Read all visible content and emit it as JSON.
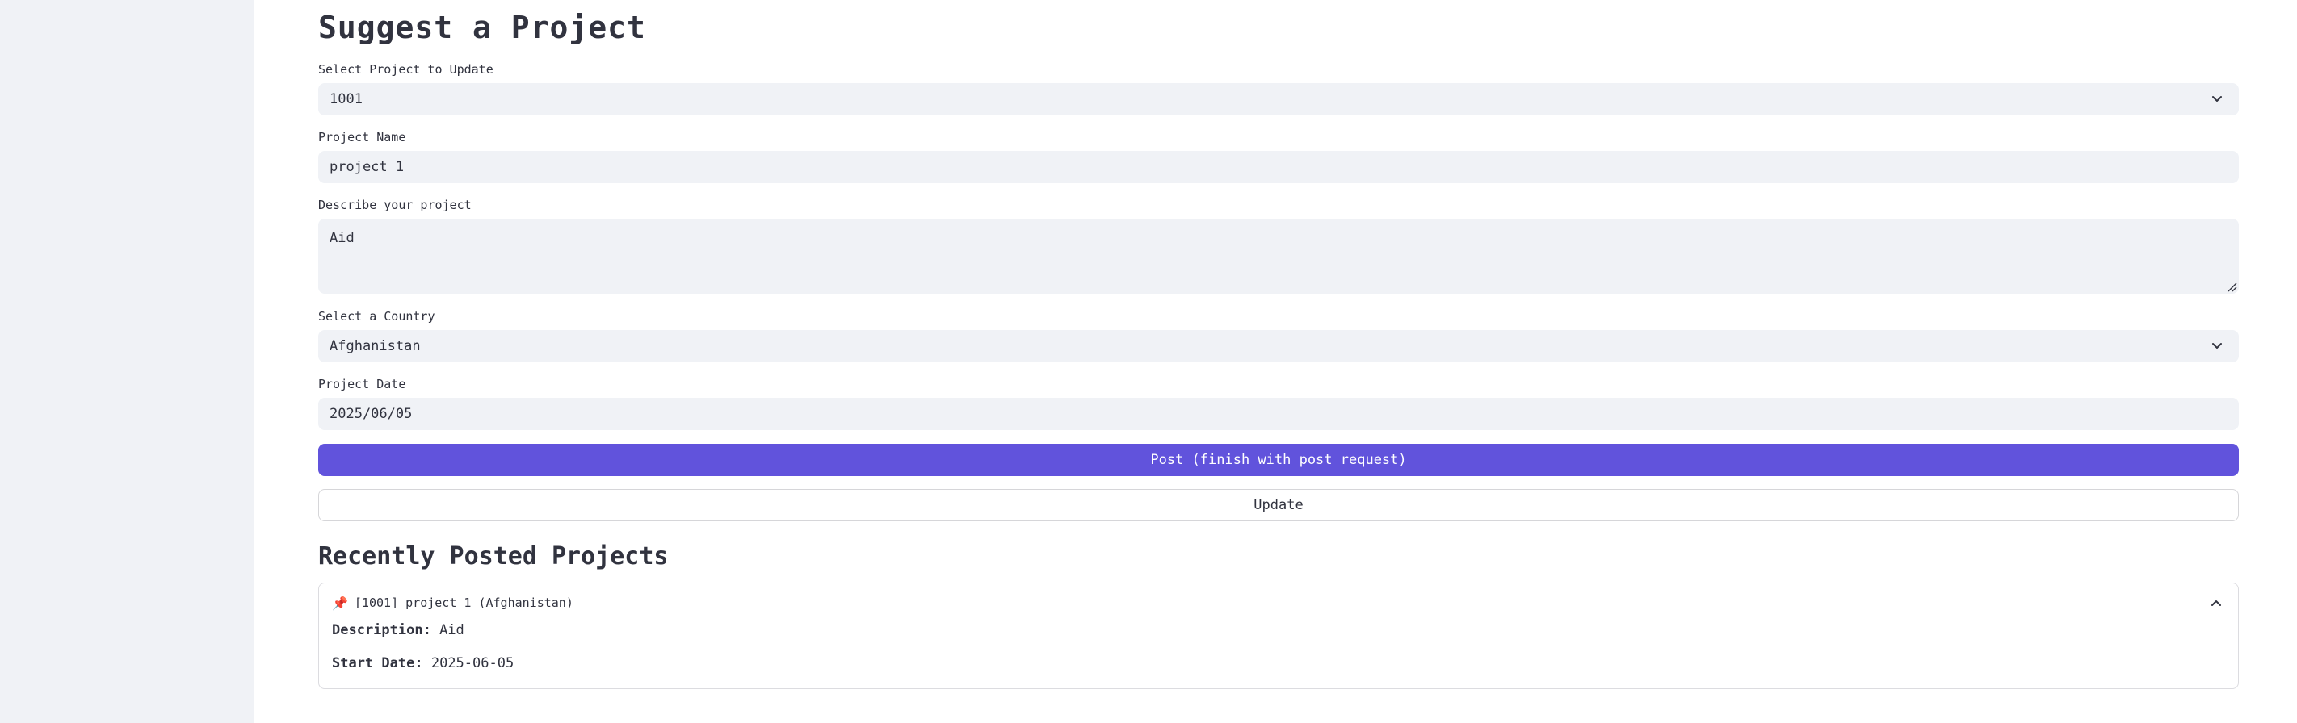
{
  "page": {
    "title": "Suggest a Project",
    "select_project": {
      "label": "Select Project to Update",
      "value": "1001"
    },
    "project_name": {
      "label": "Project Name",
      "value": "project 1"
    },
    "description": {
      "label": "Describe your project",
      "value": "Aid"
    },
    "country": {
      "label": "Select a Country",
      "value": "Afghanistan"
    },
    "project_date": {
      "label": "Project Date",
      "value": "2025/06/05"
    },
    "post_button": "Post (finish with post request)",
    "update_button": "Update",
    "recent_title": "Recently Posted Projects",
    "recent_items": [
      {
        "header": "[1001] project 1 (Afghanistan)",
        "description_label": "Description:",
        "description_value": "Aid",
        "start_label": "Start Date:",
        "start_value": "2025-06-05"
      }
    ]
  },
  "colors": {
    "accent": "#6153dc",
    "sidebar_bg": "#f0f2f6",
    "field_bg": "#f0f2f6",
    "text": "#31333f"
  },
  "icons": {
    "select_chevron": "chevron-down-icon",
    "expander_chevron": "chevron-up-icon",
    "pin": "pushpin-icon"
  }
}
